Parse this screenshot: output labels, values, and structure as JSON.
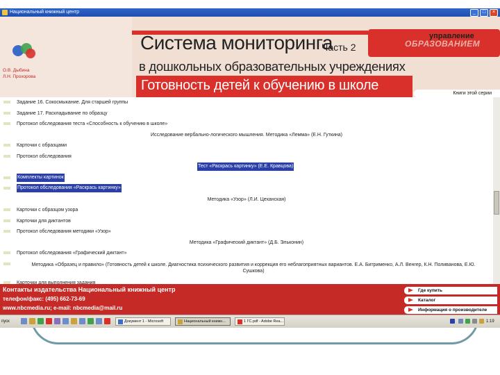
{
  "window": {
    "title": "Национальный книжный центр"
  },
  "header": {
    "authors": [
      "О.В. Дыбина",
      "Л.Н. Прохорова"
    ],
    "title": "Система мониторинга",
    "part": "Часть 2",
    "subtitle": "в дошкольных образовательных учреждениях",
    "section": "Готовность детей к обучению в школе",
    "brand_top": "управление",
    "brand_bottom": "ОБРАЗОВАНИЕМ",
    "series_button": "Книги этой серии"
  },
  "content": {
    "rows": [
      {
        "text": "Задание 16. Сокосмыкание. Для старшей группы",
        "style": "bullet"
      },
      {
        "text": "Задание 17. Раскладывание по образцу",
        "style": "bullet"
      },
      {
        "text": "Протокол обследования теста «Способность к обучению в школе»",
        "style": "bullet"
      },
      {
        "text": "Исследование вербально-логического мышления. Методика «Лемма» (Е.Н. Гуткина)",
        "style": "center"
      },
      {
        "text": "Карточки с образцами",
        "style": "bullet"
      },
      {
        "text": "Протокол обследования",
        "style": "bullet"
      },
      {
        "text": "Тест «Раскрась картинку» (Е.Е. Кравцова)",
        "style": "center-selected"
      },
      {
        "text": "Комплекты картинок",
        "style": "bullet-selected"
      },
      {
        "text": "Протокол обследования «Раскрась картинку»",
        "style": "bullet-selected"
      },
      {
        "text": "Методика «Узор» (Л.И. Цеханская)",
        "style": "center"
      },
      {
        "text": "Карточки с образцом узора",
        "style": "bullet"
      },
      {
        "text": "Карточки для диктантов",
        "style": "bullet"
      },
      {
        "text": "Протокол обследования методики «Узор»",
        "style": "bullet"
      },
      {
        "text": "Методика «Графический диктант» (Д.Б. Эльконин)",
        "style": "center"
      },
      {
        "text": "Протокол обследования «Графический диктант»",
        "style": "bullet"
      },
      {
        "text": "Методика «Образец и правило» (Готовность детей к школе. Диагностика психического развития и коррекция его неблагоприятных вариантов. Е.А. Битрименко, А.Л. Венгер, К.Н. Поливанова, Е.Ю. Сушкова)",
        "style": "multiline"
      },
      {
        "text": "Карточки для выполнения задания",
        "style": "bullet"
      }
    ]
  },
  "footer": {
    "contacts": "Контакты издательства Национальный книжный центр",
    "phone": "телефон/факс: (495) 662-73-69",
    "web": "www.nbcmedia.ru; e-mail: nbcmedia@mail.ru",
    "links": [
      "Где купить",
      "Каталог",
      "Информация о производителе"
    ]
  },
  "taskbar": {
    "start": "пуск",
    "tasks": [
      "Документ 1 - Microsoft",
      "Национальный книжн...",
      "1 ГС.pdf - Adobe Rea..."
    ],
    "clock": "1:19"
  },
  "colors": {
    "accent": "#d9302c",
    "header_bg": "#f1dfd4",
    "selection": "#2a40a8"
  }
}
